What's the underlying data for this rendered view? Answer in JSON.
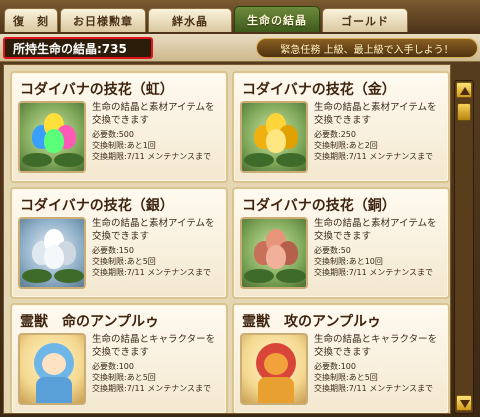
{
  "tabs": [
    {
      "label": "復　刻",
      "active": false
    },
    {
      "label": "お日様勲章",
      "active": false
    },
    {
      "label": "絆水晶",
      "active": false
    },
    {
      "label": "生命の結晶",
      "active": true
    },
    {
      "label": "ゴールド",
      "active": false
    }
  ],
  "header": {
    "gem_count_text": "所持生命の結晶:735",
    "notice": "緊急任務 上級、最上級で入手しよう！"
  },
  "items": [
    {
      "title": "コダイバナの技花（虹）",
      "desc": "生命の結晶と素材アイテムを交換できます",
      "required": "必要数:500",
      "limit": "交換制限:あと1回",
      "period": "交換期限:7/11 メンテナンスまで",
      "icon": "rainbow-flower-icon"
    },
    {
      "title": "コダイバナの技花（金）",
      "desc": "生命の結晶と素材アイテムを交換できます",
      "required": "必要数:250",
      "limit": "交換制限:あと2回",
      "period": "交換期限:7/11 メンテナンスまで",
      "icon": "gold-flower-icon"
    },
    {
      "title": "コダイバナの技花（銀）",
      "desc": "生命の結晶と素材アイテムを交換できます",
      "required": "必要数:150",
      "limit": "交換制限:あと5回",
      "period": "交換期限:7/11 メンテナンスまで",
      "icon": "silver-flower-icon"
    },
    {
      "title": "コダイバナの技花（銅）",
      "desc": "生命の結晶と素材アイテムを交換できます",
      "required": "必要数:50",
      "limit": "交換制限:あと10回",
      "period": "交換期限:7/11 メンテナンスまで",
      "icon": "bronze-flower-icon"
    },
    {
      "title": "霊獣　命のアンプルゥ",
      "desc": "生命の結晶とキャラクターを交換できます",
      "required": "必要数:100",
      "limit": "交換制限:あと5回",
      "period": "交換期限:7/11 メンテナンスまで",
      "icon": "blue-spirit-beast-icon"
    },
    {
      "title": "霊獣　攻のアンプルゥ",
      "desc": "生命の結晶とキャラクターを交換できます",
      "required": "必要数:100",
      "limit": "交換制限:あと5回",
      "period": "交換期限:7/11 メンテナンスまで",
      "icon": "red-spirit-beast-icon"
    }
  ],
  "colors": {
    "active_tab": "#4f6e28",
    "highlight_border": "#e0141c"
  }
}
